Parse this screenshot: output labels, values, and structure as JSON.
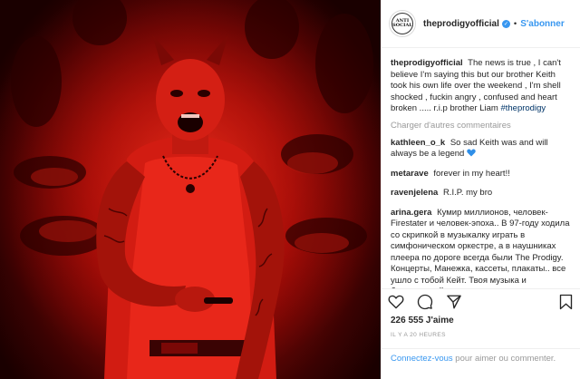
{
  "header": {
    "avatar_text": "ANTI SOCIAL",
    "username": "theprodigyofficial",
    "separator": "•",
    "follow_label": "S'abonner"
  },
  "caption": {
    "username": "theprodigyofficial",
    "text": "The news is true , I can't believe I'm saying this but our brother Keith took his own life over the weekend , I'm shell shocked , fuckin angry , confused and heart broken ..... r.i.p brother Liam",
    "hashtag": "#theprodigy"
  },
  "load_more_label": "Charger d'autres commentaires",
  "comments": [
    {
      "username": "kathleen_o_k",
      "text": "So sad Keith was and will always be a legend"
    },
    {
      "username": "metarave",
      "text": "forever in my heart!!"
    },
    {
      "username": "ravenjelena",
      "text": "R.I.P. my bro"
    },
    {
      "username": "arina.gera",
      "text": "Кумир миллионов, человек-Firestater и человек-эпоха.. В 97-году ходила со скрипкой в музыкалку играть в симфоническом оркестре, а в наушниках плеера по дороге всегда были The Prodigy. Концерты, Манежка, кассеты, плакаты.. все ушло с тобой Кейт. Твоя музыка и бессмертный голос навсегда"
    }
  ],
  "actions": [
    "heart-icon",
    "comment-icon",
    "share-icon",
    "bookmark-icon"
  ],
  "likes_label": "226 555 J'aime",
  "timestamp": "IL Y A 20 HEURES",
  "login": {
    "link_label": "Connectez-vous",
    "text": " pour aimer ou commenter."
  },
  "colors": {
    "link_blue": "#3897f0",
    "hashtag_blue": "#003569",
    "muted_gray": "#999999",
    "border": "#efefef",
    "photo_red": "#c81a10"
  }
}
